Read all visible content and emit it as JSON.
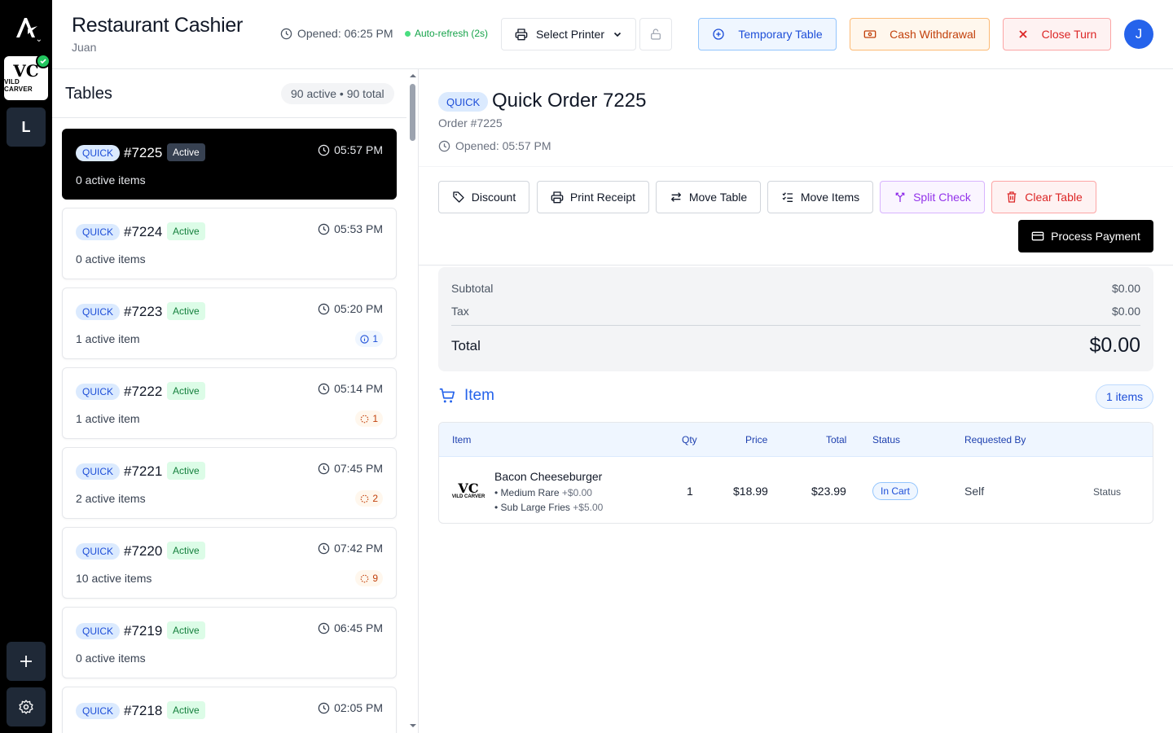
{
  "header": {
    "title": "Restaurant Cashier",
    "user": "Juan",
    "opened": "Opened: 06:25 PM",
    "auto_refresh": "Auto-refresh (2s)",
    "printer_label": "Select Printer",
    "temp_table_label": "Temporary Table",
    "cash_withdrawal_label": "Cash Withdrawal",
    "close_turn_label": "Close Turn",
    "avatar_initial": "J"
  },
  "rail": {
    "brand_line1": "VC",
    "brand_line2": "VILD CARVER",
    "workspace_initial": "L"
  },
  "tables": {
    "title": "Tables",
    "summary": "90 active • 90 total",
    "items": [
      {
        "chip": "QUICK",
        "number": "#7225",
        "status": "Active",
        "time": "05:57 PM",
        "items": "0 active items",
        "badge": "",
        "badge_type": "",
        "selected": true
      },
      {
        "chip": "QUICK",
        "number": "#7224",
        "status": "Active",
        "time": "05:53 PM",
        "items": "0 active items",
        "badge": "",
        "badge_type": "",
        "selected": false
      },
      {
        "chip": "QUICK",
        "number": "#7223",
        "status": "Active",
        "time": "05:20 PM",
        "items": "1 active item",
        "badge": "1",
        "badge_type": "info",
        "selected": false
      },
      {
        "chip": "QUICK",
        "number": "#7222",
        "status": "Active",
        "time": "05:14 PM",
        "items": "1 active item",
        "badge": "1",
        "badge_type": "pend",
        "selected": false
      },
      {
        "chip": "QUICK",
        "number": "#7221",
        "status": "Active",
        "time": "07:45 PM",
        "items": "2 active items",
        "badge": "2",
        "badge_type": "pend",
        "selected": false
      },
      {
        "chip": "QUICK",
        "number": "#7220",
        "status": "Active",
        "time": "07:42 PM",
        "items": "10 active items",
        "badge": "9",
        "badge_type": "pend",
        "selected": false
      },
      {
        "chip": "QUICK",
        "number": "#7219",
        "status": "Active",
        "time": "06:45 PM",
        "items": "0 active items",
        "badge": "",
        "badge_type": "",
        "selected": false
      },
      {
        "chip": "QUICK",
        "number": "#7218",
        "status": "Active",
        "time": "02:05 PM",
        "items": "",
        "badge": "",
        "badge_type": "",
        "selected": false
      }
    ]
  },
  "order": {
    "chip": "QUICK",
    "title": "Quick Order 7225",
    "subtitle": "Order #7225",
    "opened": "Opened: 05:57 PM",
    "actions": {
      "discount": "Discount",
      "print_receipt": "Print Receipt",
      "move_table": "Move Table",
      "move_items": "Move Items",
      "split_check": "Split Check",
      "clear_table": "Clear Table",
      "process_payment": "Process Payment"
    },
    "totals": {
      "subtotal_label": "Subtotal",
      "subtotal": "$0.00",
      "tax_label": "Tax",
      "tax": "$0.00",
      "total_label": "Total",
      "total": "$0.00"
    },
    "items_section": {
      "title": "Item",
      "count": "1 items",
      "columns": [
        "Item",
        "Qty",
        "Price",
        "Total",
        "Status",
        "Requested By"
      ],
      "rows": [
        {
          "name": "Bacon Cheeseburger",
          "modifiers": [
            {
              "name": "• Medium Rare",
              "price": "+$0.00"
            },
            {
              "name": "• Sub Large Fries",
              "price": "+$5.00"
            }
          ],
          "qty": "1",
          "price": "$18.99",
          "total": "$23.99",
          "status": "In Cart",
          "requested_by": "Self",
          "action": "Status"
        }
      ]
    }
  },
  "colors": {
    "accent": "#2563eb",
    "active_green": "#15803d",
    "danger": "#dc2626",
    "warning": "#c2410c",
    "purple": "#9333ea"
  }
}
